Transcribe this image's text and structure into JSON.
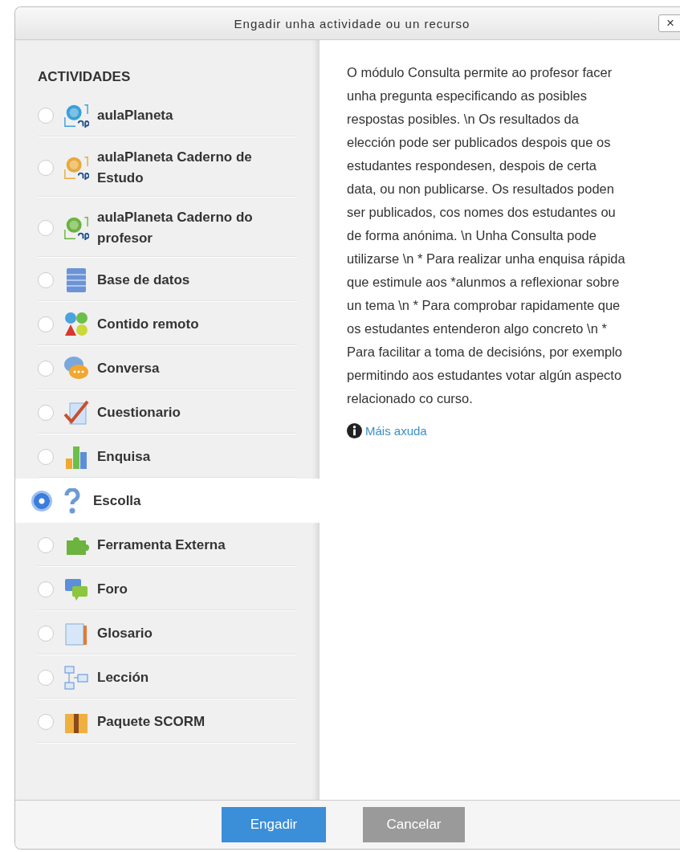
{
  "window": {
    "title": "Engadir unha actividade ou un recurso",
    "close": "×"
  },
  "sidebar": {
    "heading": "ACTIVIDADES",
    "items": [
      {
        "label": "aulaPlaneta",
        "selected": false
      },
      {
        "label": "aulaPlaneta Caderno de Estudo",
        "selected": false
      },
      {
        "label": "aulaPlaneta Caderno do profesor",
        "selected": false
      },
      {
        "label": "Base de datos",
        "selected": false
      },
      {
        "label": "Contido remoto",
        "selected": false
      },
      {
        "label": "Conversa",
        "selected": false
      },
      {
        "label": "Cuestionario",
        "selected": false
      },
      {
        "label": "Enquisa",
        "selected": false
      },
      {
        "label": "Escolla",
        "selected": true
      },
      {
        "label": "Ferramenta Externa",
        "selected": false
      },
      {
        "label": "Foro",
        "selected": false
      },
      {
        "label": "Glosario",
        "selected": false
      },
      {
        "label": "Lección",
        "selected": false
      },
      {
        "label": "Paquete SCORM",
        "selected": false
      }
    ]
  },
  "description": {
    "text": "O módulo Consulta permite ao profesor facer unha pregunta especificando as posibles respostas posibles. \\n Os resultados da elección pode ser publicados despois que os estudantes respondesen, despois de certa data, ou non publicarse. Os resultados poden ser publicados, cos nomes dos estudantes ou de forma anónima. \\n Unha Consulta pode utilizarse \\n * Para realizar unha enquisa rápida que estimule aos *alunmos a reflexionar sobre un tema \\n * Para comprobar rapidamente que os estudantes entenderon algo concreto \\n * Para facilitar a toma de decisións, por exemplo permitindo aos estudantes votar algún aspecto relacionado co curso.",
    "help_link": "Máis axuda"
  },
  "buttons": [
    {
      "label": "Engadir",
      "kind": "primary"
    },
    {
      "label": "Cancelar",
      "kind": "secondary"
    }
  ]
}
